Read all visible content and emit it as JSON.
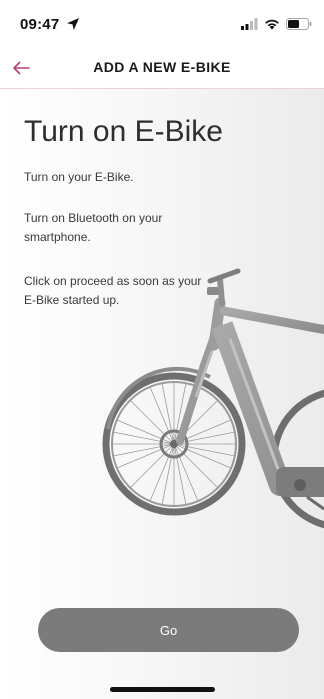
{
  "status_bar": {
    "time": "09:47",
    "icons": [
      "location-arrow-icon",
      "signal-bars-icon",
      "wifi-icon",
      "battery-icon"
    ]
  },
  "header": {
    "title": "ADD A NEW E-BIKE",
    "back_icon": "arrow-left-icon"
  },
  "main": {
    "title": "Turn on E-Bike",
    "instructions": [
      "Turn on your E-Bike.",
      "Turn on Bluetooth on your smartphone.",
      "Click on proceed as soon as your E-Bike started up."
    ],
    "illustration": "e-bike-illustration"
  },
  "actions": {
    "go_label": "Go"
  },
  "colors": {
    "accent": "#b0407a",
    "button": "#7b7b7b",
    "header_divider": "#e6d3de"
  }
}
